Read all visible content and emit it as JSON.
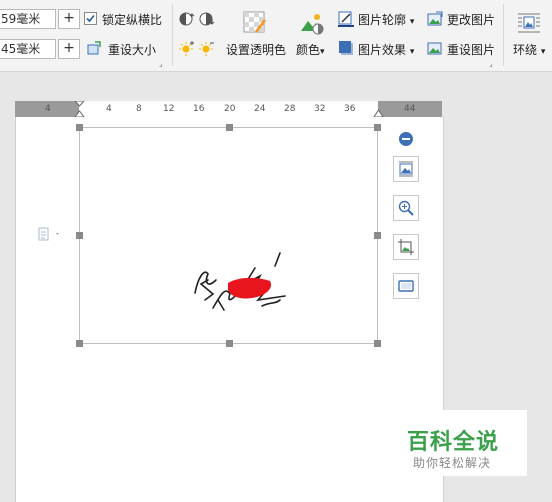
{
  "ribbon": {
    "width_value": "59毫米",
    "height_value": "45毫米",
    "stepper_symbol": "+",
    "lock_ratio_label": "锁定纵横比",
    "reset_size_label": "重设大小",
    "set_transparent_label": "设置透明色",
    "color_label": "颜色",
    "picture_outline_label": "图片轮廓",
    "picture_effect_label": "图片效果",
    "change_picture_label": "更改图片",
    "reset_picture_label": "重设图片",
    "wrap_label": "环绕",
    "dropdown_glyph": "▾",
    "corner_glyph": "⌟"
  },
  "ruler": {
    "ticks": [
      "4",
      "4",
      "8",
      "12",
      "16",
      "20",
      "24",
      "28",
      "32",
      "36",
      "44"
    ]
  },
  "watermark": {
    "title": "百科全说",
    "subtitle": "助你轻松解决"
  },
  "colors": {
    "accent_green": "#3aa04a",
    "redaction": "#e8141e",
    "side_blue": "#3d6fb5"
  }
}
